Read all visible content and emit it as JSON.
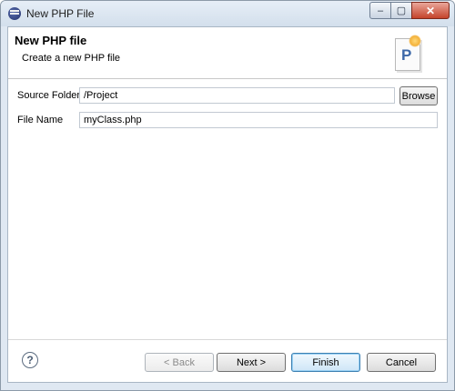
{
  "window": {
    "title": "New PHP File",
    "controls": {
      "minimize": "–",
      "maximize": "▢",
      "close": "✕"
    }
  },
  "banner": {
    "title": "New PHP file",
    "subtitle": "Create a new PHP file",
    "icon_letter": "P"
  },
  "form": {
    "source_folder": {
      "label": "Source Folder",
      "value": "/Project"
    },
    "file_name": {
      "label": "File Name",
      "value": "myClass.php"
    },
    "browse_label": "Browse"
  },
  "footer": {
    "help_glyph": "?",
    "back_label": "< Back",
    "next_label": "Next >",
    "finish_label": "Finish",
    "cancel_label": "Cancel"
  }
}
